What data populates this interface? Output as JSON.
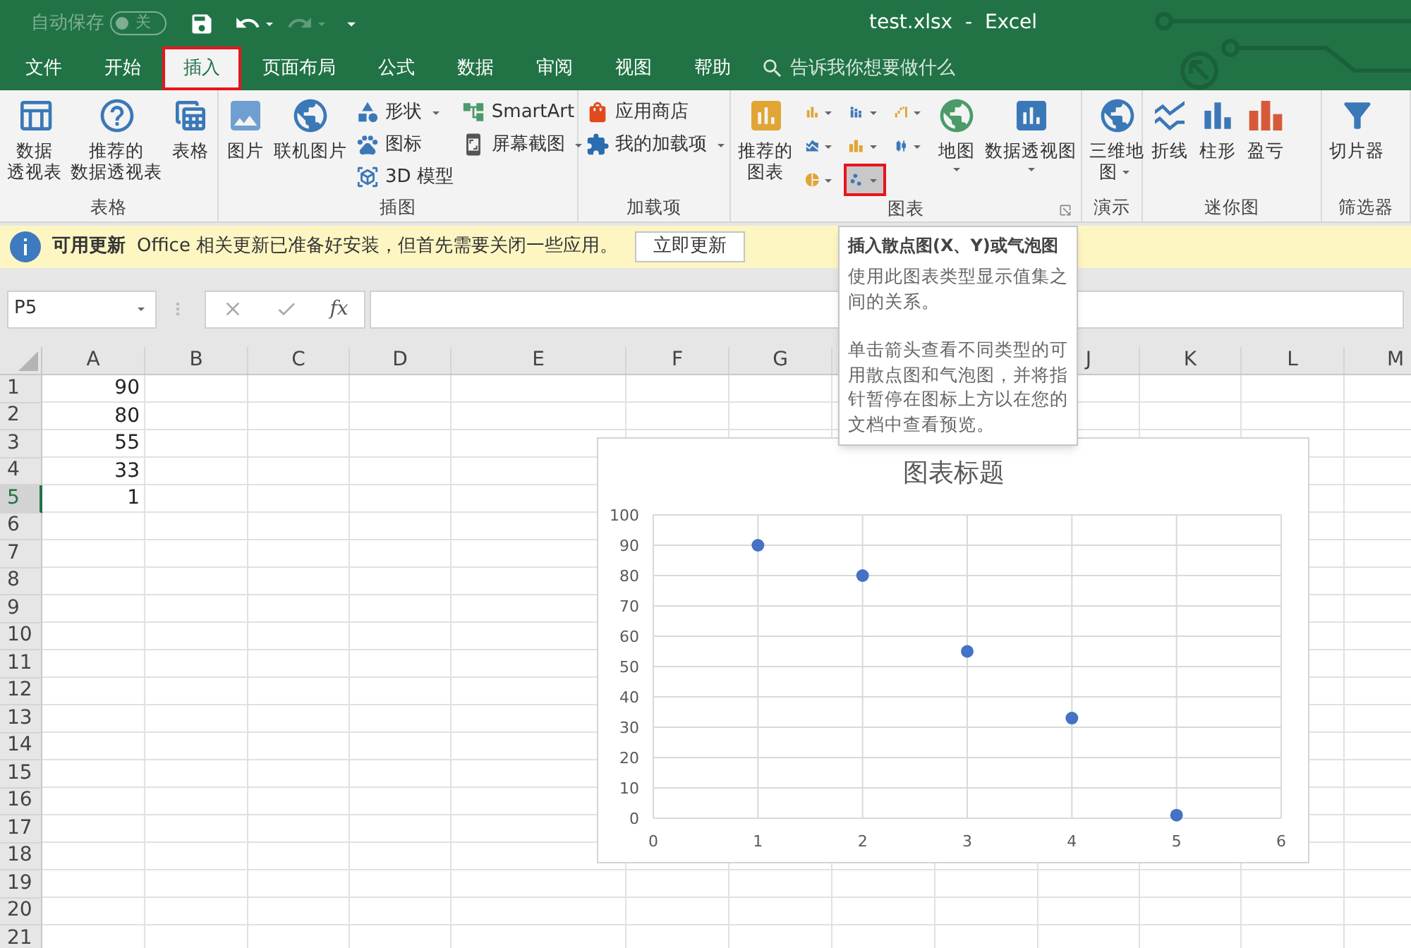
{
  "title_bar": {
    "autosave_label": "自动保存",
    "autosave_state": "关",
    "autosave_on": false,
    "title": "test.xlsx  -  Excel"
  },
  "tabs": [
    {
      "label": "文件",
      "selected": false,
      "highlighted": false
    },
    {
      "label": "开始",
      "selected": false,
      "highlighted": false
    },
    {
      "label": "插入",
      "selected": true,
      "highlighted": true
    },
    {
      "label": "页面布局",
      "selected": false,
      "highlighted": false
    },
    {
      "label": "公式",
      "selected": false,
      "highlighted": false
    },
    {
      "label": "数据",
      "selected": false,
      "highlighted": false
    },
    {
      "label": "审阅",
      "selected": false,
      "highlighted": false
    },
    {
      "label": "视图",
      "selected": false,
      "highlighted": false
    },
    {
      "label": "帮助",
      "selected": false,
      "highlighted": false
    }
  ],
  "search": {
    "placeholder": "告诉我你想要做什么"
  },
  "ribbon_groups": [
    {
      "label": "表格",
      "items": [
        {
          "kind": "large",
          "label": [
            "数据",
            "透视表"
          ]
        },
        {
          "kind": "large",
          "label": [
            "推荐的",
            "数据透视表"
          ]
        },
        {
          "kind": "large",
          "label": [
            "表格"
          ]
        }
      ]
    },
    {
      "label": "插图",
      "items": [
        {
          "kind": "large",
          "label": [
            "图片"
          ]
        },
        {
          "kind": "large",
          "label": [
            "联机图片"
          ]
        },
        {
          "kind": "stack",
          "items": [
            {
              "label": "形状",
              "dropdown": true
            },
            {
              "label": "图标",
              "dropdown": false
            },
            {
              "label": "3D 模型",
              "dropdown": false
            }
          ]
        },
        {
          "kind": "stack",
          "items": [
            {
              "label": "SmartArt",
              "dropdown": false
            },
            {
              "label": "屏幕截图",
              "dropdown": true
            }
          ]
        }
      ]
    },
    {
      "label": "加载项",
      "items": [
        {
          "kind": "stack",
          "items": [
            {
              "label": "应用商店",
              "dropdown": false
            },
            {
              "label": "我的加载项",
              "dropdown": true
            }
          ]
        }
      ]
    },
    {
      "label": "图表",
      "launcher": true,
      "items": [
        {
          "kind": "large",
          "label": [
            "推荐的",
            "图表"
          ]
        },
        {
          "kind": "grid",
          "buttons": [
            {
              "selected": false,
              "highlighted": false
            },
            {
              "selected": false,
              "highlighted": false
            },
            {
              "selected": false,
              "highlighted": false
            },
            {
              "selected": false,
              "highlighted": false
            },
            {
              "selected": false,
              "highlighted": false
            },
            {
              "selected": false,
              "highlighted": false
            },
            {
              "selected": false,
              "highlighted": false
            },
            {
              "selected": true,
              "highlighted": true
            }
          ]
        },
        {
          "kind": "large",
          "label": [
            "地图"
          ],
          "dropdown": true
        },
        {
          "kind": "large",
          "label": [
            "数据透视图"
          ],
          "dropdown": true
        }
      ]
    },
    {
      "label": "演示",
      "items": [
        {
          "kind": "large",
          "label": [
            "三维地",
            "图"
          ],
          "dropdown": true,
          "caret_inline": true
        }
      ]
    },
    {
      "label": "迷你图",
      "items": [
        {
          "kind": "large",
          "label": [
            "折线"
          ]
        },
        {
          "kind": "large",
          "label": [
            "柱形"
          ]
        },
        {
          "kind": "large",
          "label": [
            "盈亏"
          ]
        }
      ]
    },
    {
      "label": "筛选器",
      "items": [
        {
          "kind": "large",
          "label": [
            "切片器"
          ]
        }
      ]
    }
  ],
  "info_bar": {
    "title": "可用更新",
    "message": "Office 相关更新已准备好安装，但首先需要关闭一些应用。",
    "button": "立即更新"
  },
  "formula_bar": {
    "name_box": "P5",
    "function_label": "fx"
  },
  "sheet": {
    "columns": [
      "A",
      "B",
      "C",
      "D",
      "E",
      "F",
      "G",
      "J",
      "K",
      "L",
      "M"
    ],
    "rows": [
      {
        "label": "1",
        "selected": false,
        "cells": [
          "90"
        ]
      },
      {
        "label": "2",
        "selected": false,
        "cells": [
          "80"
        ]
      },
      {
        "label": "3",
        "selected": false,
        "cells": [
          "55"
        ]
      },
      {
        "label": "4",
        "selected": false,
        "cells": [
          "33"
        ]
      },
      {
        "label": "5",
        "selected": true,
        "cells": [
          "1"
        ]
      },
      {
        "label": "6",
        "selected": false
      },
      {
        "label": "7",
        "selected": false
      },
      {
        "label": "8",
        "selected": false
      },
      {
        "label": "9",
        "selected": false
      },
      {
        "label": "10",
        "selected": false
      },
      {
        "label": "11",
        "selected": false
      },
      {
        "label": "12",
        "selected": false
      },
      {
        "label": "13",
        "selected": false
      },
      {
        "label": "14",
        "selected": false
      },
      {
        "label": "15",
        "selected": false
      },
      {
        "label": "16",
        "selected": false
      },
      {
        "label": "17",
        "selected": false
      },
      {
        "label": "18",
        "selected": false
      },
      {
        "label": "19",
        "selected": false
      },
      {
        "label": "20",
        "selected": false
      },
      {
        "label": "21",
        "selected": false
      }
    ]
  },
  "tooltip": {
    "title": "插入散点图(X、Y)或气泡图",
    "paragraphs": [
      "使用此图表类型显示值集之间的关系。",
      "单击箭头查看不同类型的可用散点图和气泡图，并将指针暂停在图标上方以在您的文档中查看预览。"
    ]
  },
  "chart": {
    "chart_data": {
      "type": "scatter",
      "title": "图表标题",
      "grid": true,
      "x": [
        1,
        2,
        3,
        4,
        5
      ],
      "series": [
        {
          "color": "#4472c4",
          "values": [
            90,
            80,
            55,
            33,
            1
          ]
        }
      ],
      "xlim": [
        0,
        6
      ],
      "ylim": [
        0,
        100
      ],
      "xticks": [
        0,
        1,
        2,
        3,
        4,
        5,
        6
      ],
      "yticks": [
        0,
        10,
        20,
        30,
        40,
        50,
        60,
        70,
        80,
        90,
        100
      ]
    }
  }
}
